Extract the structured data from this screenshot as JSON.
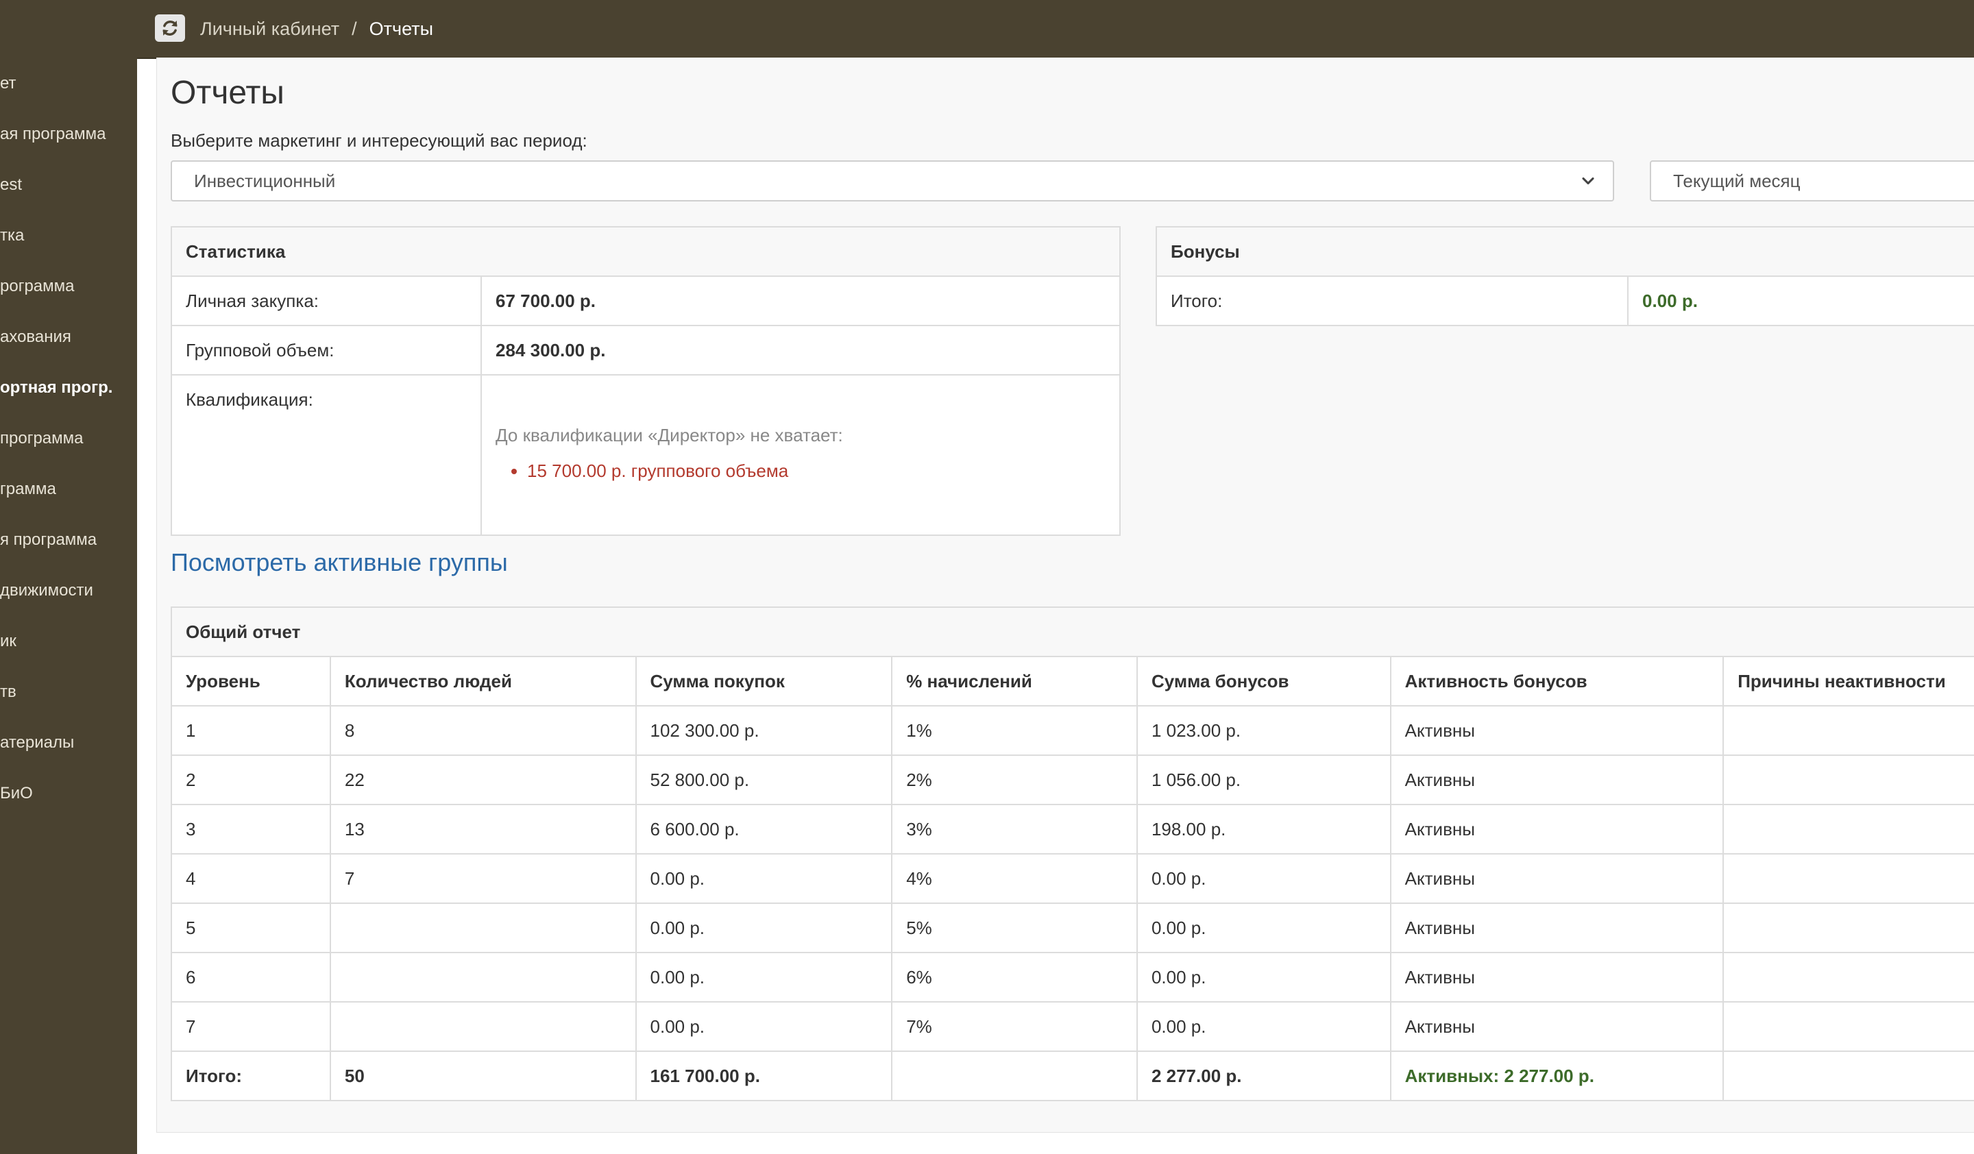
{
  "header": {
    "refresh_icon": "refresh-icon",
    "breadcrumb": {
      "home": "Личный кабинет",
      "separator": "/",
      "current": "Отчеты"
    }
  },
  "sidebar": {
    "items": [
      {
        "label": "ет"
      },
      {
        "label": "ая программа"
      },
      {
        "label": "est"
      },
      {
        "label": "тка"
      },
      {
        "label": "рограмма"
      },
      {
        "label": "ахования"
      },
      {
        "label": "ортная прогр.",
        "active": true
      },
      {
        "label": "программа"
      },
      {
        "label": "грамма"
      },
      {
        "label": "я программа"
      },
      {
        "label": "движимости"
      },
      {
        "label": "ик"
      },
      {
        "label": "тв"
      },
      {
        "label": "атериалы"
      },
      {
        "label": "БиО"
      }
    ]
  },
  "page": {
    "title": "Отчеты",
    "period_label": "Выберите маркетинг и интересующий вас период:",
    "marketing_select": "Инвестиционный",
    "period_select": "Текущий месяц"
  },
  "stats": {
    "title": "Статистика",
    "personal_label": "Личная закупка:",
    "personal_value": "67 700.00 р.",
    "group_label": "Групповой объем:",
    "group_value": "284 300.00 р.",
    "qual_label": "Квалификация:",
    "qual_note": "До квалификации «Директор» не хватает:",
    "qual_items": [
      "15 700.00 р. группового объема"
    ]
  },
  "bonuses": {
    "title": "Бонусы",
    "total_label": "Итого:",
    "total_value": "0.00 р."
  },
  "links": {
    "active_groups": "Посмотреть активные группы"
  },
  "report": {
    "title": "Общий отчет",
    "columns": [
      "Уровень",
      "Количество людей",
      "Сумма покупок",
      "% начислений",
      "Сумма бонусов",
      "Активность бонусов",
      "Причины неактивности"
    ],
    "rows": [
      [
        "1",
        "8",
        "102 300.00 р.",
        "1%",
        "1 023.00 р.",
        "Активны",
        ""
      ],
      [
        "2",
        "22",
        "52 800.00 р.",
        "2%",
        "1 056.00 р.",
        "Активны",
        ""
      ],
      [
        "3",
        "13",
        "6 600.00 р.",
        "3%",
        "198.00 р.",
        "Активны",
        ""
      ],
      [
        "4",
        "7",
        "0.00 р.",
        "4%",
        "0.00 р.",
        "Активны",
        ""
      ],
      [
        "5",
        "",
        "0.00 р.",
        "5%",
        "0.00 р.",
        "Активны",
        ""
      ],
      [
        "6",
        "",
        "0.00 р.",
        "6%",
        "0.00 р.",
        "Активны",
        ""
      ],
      [
        "7",
        "",
        "0.00 р.",
        "7%",
        "0.00 р.",
        "Активны",
        ""
      ]
    ],
    "total": [
      "Итого:",
      "50",
      "161 700.00 р.",
      "",
      "2 277.00 р.",
      "Активных: 2 277.00 р.",
      ""
    ]
  },
  "colors": {
    "topbar": "#4a4230",
    "link": "#2c6aa8",
    "warning": "#b33a2e",
    "positive": "#3d6b2a"
  }
}
